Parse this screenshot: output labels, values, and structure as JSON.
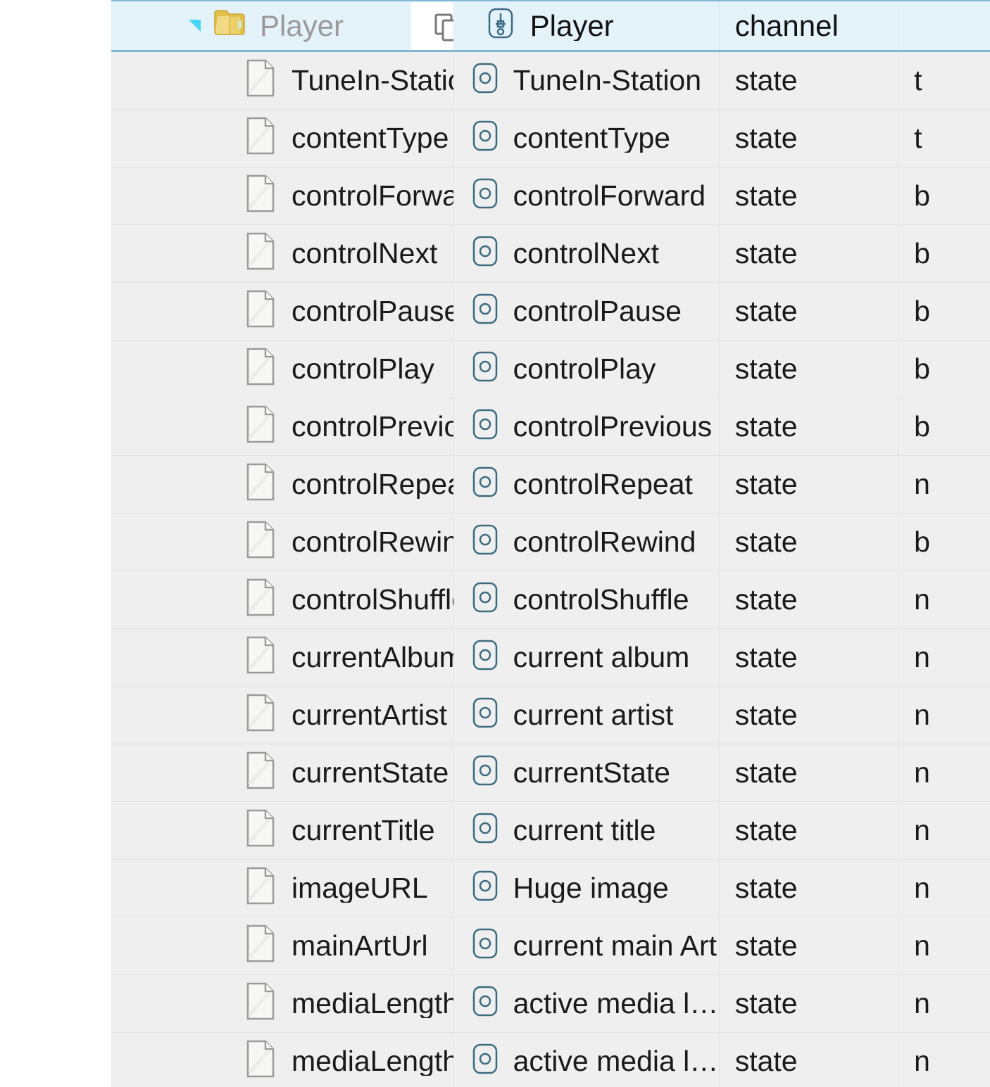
{
  "tree": {
    "header": {
      "disclosure_icon": "triangle-collapse-icon",
      "folder_icon": "folder-icon",
      "name": "Player",
      "copy_icon": "copy-icon",
      "thing_icon": "channel-icon",
      "label": "Player",
      "kind": "channel",
      "type": "",
      "selected": true,
      "bg_color": "#e4f2fa",
      "border_color": "#7fb9d6"
    },
    "columns": [
      {
        "key": "name",
        "title": ""
      },
      {
        "key": "label",
        "title": ""
      },
      {
        "key": "kind",
        "title": ""
      },
      {
        "key": "type",
        "title": ""
      }
    ],
    "rows": [
      {
        "name": "TuneIn-Station",
        "label": "TuneIn-Station",
        "kind": "state",
        "type": "t"
      },
      {
        "name": "contentType",
        "label": "contentType",
        "kind": "state",
        "type": "t"
      },
      {
        "name": "controlForward",
        "label": "controlForward",
        "kind": "state",
        "type": "b"
      },
      {
        "name": "controlNext",
        "label": "controlNext",
        "kind": "state",
        "type": "b"
      },
      {
        "name": "controlPause",
        "label": "controlPause",
        "kind": "state",
        "type": "b"
      },
      {
        "name": "controlPlay",
        "label": "controlPlay",
        "kind": "state",
        "type": "b"
      },
      {
        "name": "controlPrevious",
        "label": "controlPrevious",
        "kind": "state",
        "type": "b"
      },
      {
        "name": "controlRepeat",
        "label": "controlRepeat",
        "kind": "state",
        "type": "n"
      },
      {
        "name": "controlRewind",
        "label": "controlRewind",
        "kind": "state",
        "type": "b"
      },
      {
        "name": "controlShuffle",
        "label": "controlShuffle",
        "kind": "state",
        "type": "n"
      },
      {
        "name": "currentAlbum",
        "label": "current album",
        "kind": "state",
        "type": "n"
      },
      {
        "name": "currentArtist",
        "label": "current artist",
        "kind": "state",
        "type": "n"
      },
      {
        "name": "currentState",
        "label": "currentState",
        "kind": "state",
        "type": "n"
      },
      {
        "name": "currentTitle",
        "label": "current title",
        "kind": "state",
        "type": "n"
      },
      {
        "name": "imageURL",
        "label": "Huge image",
        "kind": "state",
        "type": "n"
      },
      {
        "name": "mainArtUrl",
        "label": "current main Art",
        "kind": "state",
        "type": "n"
      },
      {
        "name": "mediaLength",
        "label": "active media le…",
        "kind": "state",
        "type": "n"
      },
      {
        "name": "mediaLengthS",
        "label": "active media le…",
        "kind": "state",
        "type": "n"
      }
    ],
    "icons": {
      "row_name_icon": "document-icon",
      "row_label_icon": "item-icon"
    },
    "colors": {
      "row_bg": "#efefef",
      "row_divider": "#e2e2e2",
      "text": "#1a1a1a",
      "header_text_muted": "#9a9a9a",
      "accent_blue": "#7fb9d6",
      "disclosure_cyan": "#45d7f2",
      "folder_yellow": "#e8c558",
      "icon_outline": "#3b6b80"
    }
  }
}
